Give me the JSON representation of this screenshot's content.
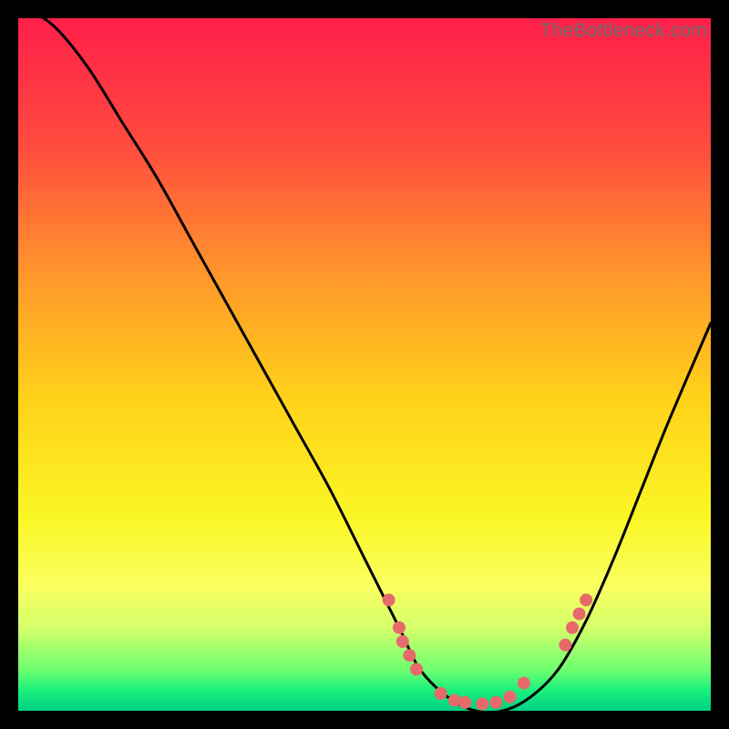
{
  "watermark": "TheBottleneck.com",
  "chart_data": {
    "type": "line",
    "title": "",
    "xlabel": "",
    "ylabel": "",
    "xlim": [
      0,
      100
    ],
    "ylim": [
      0,
      100
    ],
    "gradient_stops": [
      {
        "offset": 0.0,
        "color": "#ff1f4a"
      },
      {
        "offset": 0.18,
        "color": "#ff4a3f"
      },
      {
        "offset": 0.38,
        "color": "#ff9a2a"
      },
      {
        "offset": 0.55,
        "color": "#ffd21a"
      },
      {
        "offset": 0.72,
        "color": "#faf625"
      },
      {
        "offset": 0.82,
        "color": "#faff60"
      },
      {
        "offset": 0.88,
        "color": "#d4ff6a"
      },
      {
        "offset": 0.94,
        "color": "#70ff70"
      },
      {
        "offset": 0.97,
        "color": "#1cf07d"
      },
      {
        "offset": 1.0,
        "color": "#00d184"
      }
    ],
    "series": [
      {
        "name": "bottleneck-curve",
        "x": [
          0,
          5,
          10,
          15,
          20,
          25,
          30,
          35,
          40,
          45,
          50,
          55,
          58,
          62,
          66,
          70,
          74,
          78,
          82,
          86,
          90,
          94,
          100
        ],
        "y": [
          102,
          99,
          93,
          85,
          77,
          68,
          59,
          50,
          41,
          32,
          22,
          12,
          6,
          2,
          0,
          0,
          2,
          6,
          13,
          22,
          32,
          42,
          56
        ]
      }
    ],
    "markers": [
      {
        "x": 53.5,
        "y": 16
      },
      {
        "x": 55.0,
        "y": 12
      },
      {
        "x": 55.5,
        "y": 10
      },
      {
        "x": 56.5,
        "y": 8
      },
      {
        "x": 57.5,
        "y": 6
      },
      {
        "x": 61.0,
        "y": 2.5
      },
      {
        "x": 63.0,
        "y": 1.5
      },
      {
        "x": 64.5,
        "y": 1.2
      },
      {
        "x": 67.0,
        "y": 1.0
      },
      {
        "x": 69.0,
        "y": 1.2
      },
      {
        "x": 71.0,
        "y": 2.0
      },
      {
        "x": 73.0,
        "y": 4.0
      },
      {
        "x": 79.0,
        "y": 9.5
      },
      {
        "x": 80.0,
        "y": 12.0
      },
      {
        "x": 81.0,
        "y": 14.0
      },
      {
        "x": 82.0,
        "y": 16.0
      }
    ],
    "marker_color": "#e76a6a",
    "curve_color": "#000000"
  }
}
